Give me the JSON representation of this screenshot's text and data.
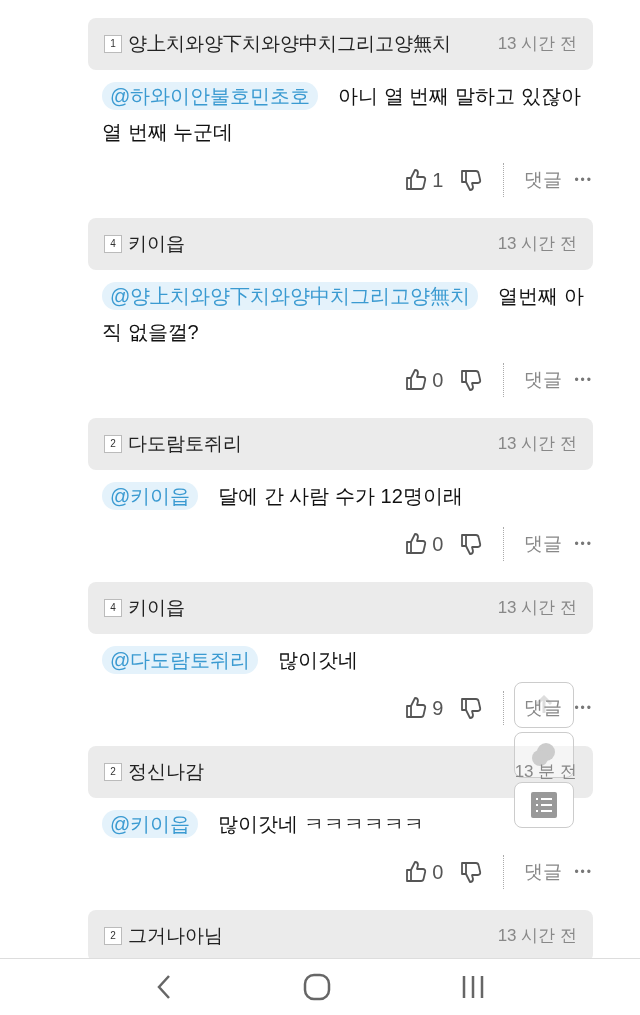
{
  "comments": [
    {
      "level": "1",
      "author": "양上치와양下치와양中치그리고양無치",
      "time": "13 시간 전",
      "mention": "@하와이안불호민초호",
      "lines": [
        "아니 열 번째 말하고 있잖아",
        "열 번째 누군데"
      ],
      "likes": "1",
      "reply": "댓글",
      "more": "•••"
    },
    {
      "level": "4",
      "author": "키이읍",
      "time": "13 시간 전",
      "mention": "@양上치와양下치와양中치그리고양無치",
      "lines": [
        "열번째 아",
        "직 없을껄?"
      ],
      "likes": "0",
      "reply": "댓글",
      "more": "•••"
    },
    {
      "level": "2",
      "author": "다도람토쥐리",
      "time": "13 시간 전",
      "mention": "@키이읍",
      "lines": [
        "달에 간 사람 수가 12명이래"
      ],
      "likes": "0",
      "reply": "댓글",
      "more": "•••"
    },
    {
      "level": "4",
      "author": "키이읍",
      "time": "13 시간 전",
      "mention": "@다도람토쥐리",
      "lines": [
        "많이갓네"
      ],
      "likes": "9",
      "reply": "댓글",
      "more": "•••"
    },
    {
      "level": "2",
      "author": "정신나감",
      "time": "13 분 전",
      "mention": "@키이읍",
      "lines": [
        "많이갓네 ㅋㅋㅋㅋㅋㅋ"
      ],
      "likes": "0",
      "reply": "댓글",
      "more": "•••"
    },
    {
      "level": "2",
      "author": "그거나아님",
      "time": "13 시간 전"
    }
  ]
}
